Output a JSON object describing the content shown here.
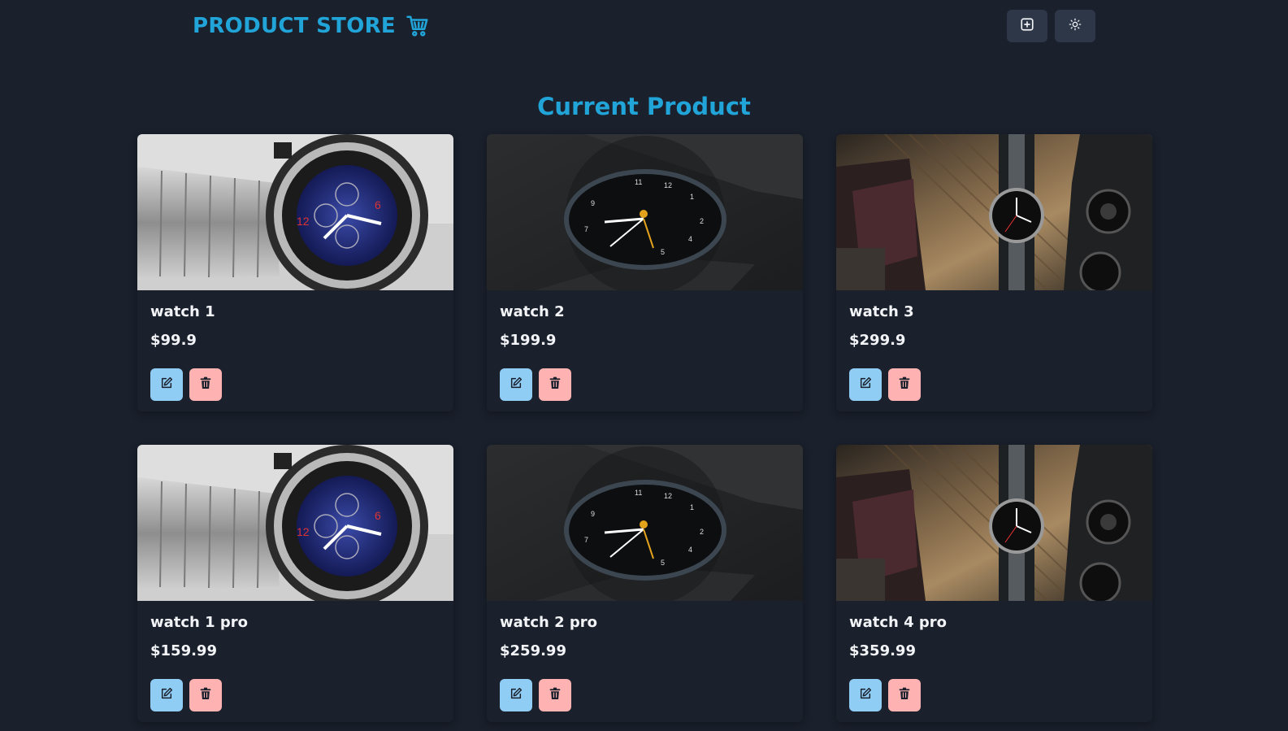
{
  "header": {
    "brand": "PRODUCT STORE",
    "brand_icon": "shopping-cart-icon",
    "buttons": [
      {
        "name": "create-product-button",
        "icon": "plus-square-icon"
      },
      {
        "name": "theme-toggle-button",
        "icon": "sun-icon"
      }
    ]
  },
  "main": {
    "title": "Current Product",
    "products": [
      {
        "name": "watch 1",
        "price": "$99.9",
        "image": "chrome-chronograph-watch"
      },
      {
        "name": "watch 2",
        "price": "$199.9",
        "image": "dark-minimal-watch"
      },
      {
        "name": "watch 3",
        "price": "$299.9",
        "image": "field-watch-with-camera"
      },
      {
        "name": "watch 1 pro",
        "price": "$159.99",
        "image": "chrome-chronograph-watch"
      },
      {
        "name": "watch 2 pro",
        "price": "$259.99",
        "image": "dark-minimal-watch"
      },
      {
        "name": "watch 4 pro",
        "price": "$359.99",
        "image": "field-watch-with-camera"
      }
    ]
  },
  "colors": {
    "background": "#1a202c",
    "accent": "#21a4d8",
    "nav_button": "#2d3748",
    "edit_button": "#90cdf4",
    "delete_button": "#feb2b2"
  }
}
